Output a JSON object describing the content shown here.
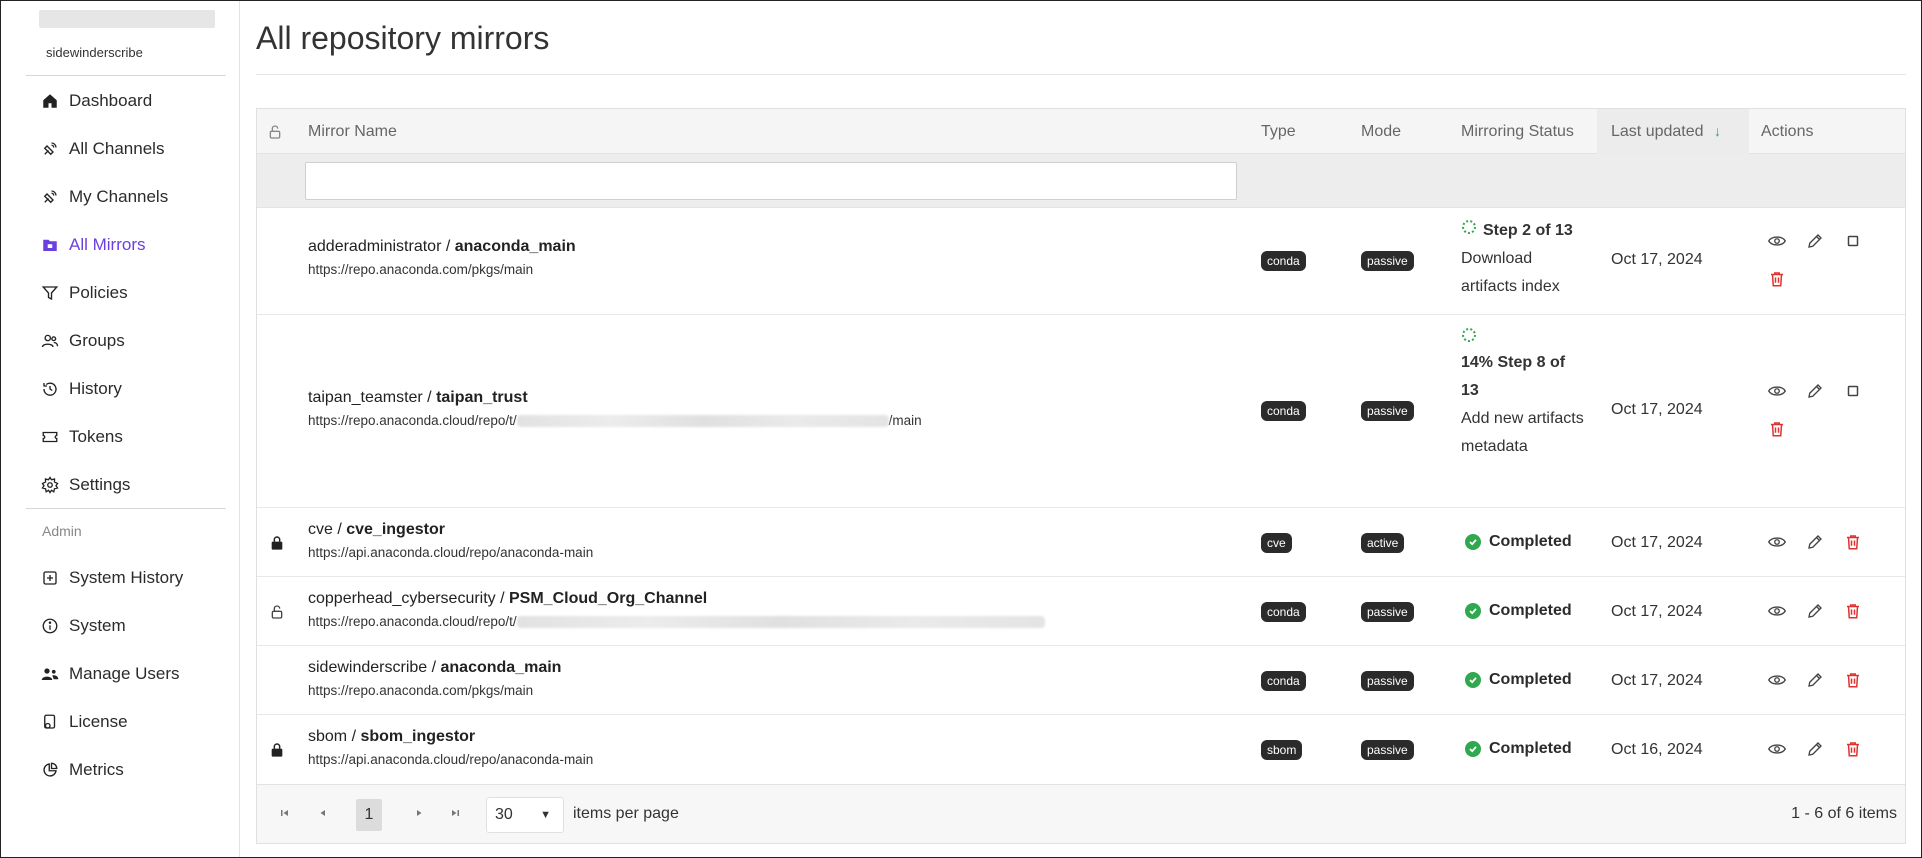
{
  "sidebar": {
    "username": "sidewinderscribe",
    "items": [
      {
        "label": "Dashboard",
        "icon": "home-icon"
      },
      {
        "label": "All Channels",
        "icon": "satellite-icon"
      },
      {
        "label": "My Channels",
        "icon": "satellite-icon"
      },
      {
        "label": "All Mirrors",
        "icon": "mirror-folder-icon"
      },
      {
        "label": "Policies",
        "icon": "filter-icon"
      },
      {
        "label": "Groups",
        "icon": "users-icon"
      },
      {
        "label": "History",
        "icon": "history-icon"
      },
      {
        "label": "Tokens",
        "icon": "ticket-icon"
      },
      {
        "label": "Settings",
        "icon": "gear-icon"
      }
    ],
    "admin_label": "Admin",
    "admin_items": [
      {
        "label": "System History",
        "icon": "system-history-icon"
      },
      {
        "label": "System",
        "icon": "info-icon"
      },
      {
        "label": "Manage Users",
        "icon": "manage-users-icon"
      },
      {
        "label": "License",
        "icon": "license-icon"
      },
      {
        "label": "Metrics",
        "icon": "pie-chart-icon"
      }
    ],
    "active_color": "#6b3fe0"
  },
  "main": {
    "title": "All repository mirrors",
    "columns": {
      "mirror_name": "Mirror Name",
      "type": "Type",
      "mode": "Mode",
      "status": "Mirroring Status",
      "last_updated": "Last updated",
      "actions": "Actions"
    },
    "rows": [
      {
        "lock": "",
        "owner": "adderadministrator / ",
        "name": "anaconda_main",
        "url": "https://repo.anaconda.com/pkgs/main",
        "url_tail": "",
        "type": "conda",
        "mode": "passive",
        "status": "progress",
        "status_pct": "",
        "status_step": "Step 2 of 13",
        "status_desc": "Download artifacts index",
        "updated": "Oct 17, 2024"
      },
      {
        "lock": "",
        "owner": "taipan_teamster / ",
        "name": "taipan_trust",
        "url": "https://repo.anaconda.cloud/repo/t/",
        "url_tail": "/main",
        "type": "conda",
        "mode": "passive",
        "status": "progress",
        "status_pct": "14%",
        "status_step": "Step 8 of 13",
        "status_desc": "Add new artifacts metadata",
        "updated": "Oct 17, 2024"
      },
      {
        "lock": "locked",
        "owner": "cve / ",
        "name": "cve_ingestor",
        "url": "https://api.anaconda.cloud/repo/anaconda-main",
        "url_tail": "",
        "type": "cve",
        "mode": "active",
        "status": "Completed",
        "updated": "Oct 17, 2024"
      },
      {
        "lock": "unlocked",
        "owner": "copperhead_cybersecurity / ",
        "name": "PSM_Cloud_Org_Channel",
        "url": "https://repo.anaconda.cloud/repo/t/",
        "url_tail": "",
        "type": "conda",
        "mode": "passive",
        "status": "Completed",
        "updated": "Oct 17, 2024"
      },
      {
        "lock": "",
        "owner": "sidewinderscribe / ",
        "name": "anaconda_main",
        "url": "https://repo.anaconda.com/pkgs/main",
        "url_tail": "",
        "type": "conda",
        "mode": "passive",
        "status": "Completed",
        "updated": "Oct 17, 2024"
      },
      {
        "lock": "locked",
        "owner": "sbom / ",
        "name": "sbom_ingestor",
        "url": "https://api.anaconda.cloud/repo/anaconda-main",
        "url_tail": "",
        "type": "sbom",
        "mode": "passive",
        "status": "Completed",
        "updated": "Oct 16, 2024"
      }
    ],
    "pager": {
      "current_page": "1",
      "per_page": "30",
      "per_page_label": "items per page",
      "info": "1 - 6 of 6 items"
    },
    "colors": {
      "complete": "#2fa84f",
      "delete": "#e0312f",
      "sort_arrow": "#2fa84f"
    }
  }
}
